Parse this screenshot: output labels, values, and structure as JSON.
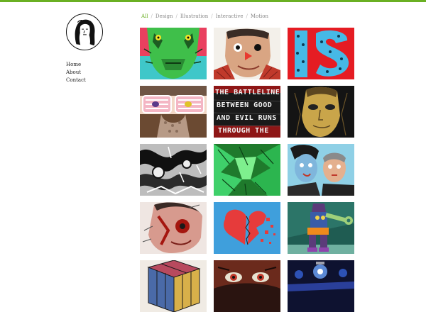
{
  "theme": {
    "accent": "#6ab023",
    "text": "#222222",
    "muted": "#888888"
  },
  "logo": {
    "icon": "portrait-sketch-icon"
  },
  "nav": {
    "items": [
      {
        "label": "Home"
      },
      {
        "label": "About"
      },
      {
        "label": "Contact"
      }
    ]
  },
  "filters": {
    "items": [
      {
        "label": "All",
        "active": true
      },
      {
        "label": "Design",
        "active": false
      },
      {
        "label": "Illustration",
        "active": false
      },
      {
        "label": "Interactive",
        "active": false
      },
      {
        "label": "Motion",
        "active": false
      }
    ]
  },
  "portfolio": {
    "tiles": [
      {
        "name": "tile-green-creature"
      },
      {
        "name": "tile-clown-face"
      },
      {
        "name": "tile-is-lettering",
        "text": "IS"
      },
      {
        "name": "tile-glasses-man"
      },
      {
        "name": "tile-battleline-text",
        "lines": [
          "THE BATTLELINE",
          "BETWEEN GOOD",
          "AND EVIL RUNS",
          "THROUGH THE"
        ]
      },
      {
        "name": "tile-golden-mask"
      },
      {
        "name": "tile-bw-abstract"
      },
      {
        "name": "tile-green-abstract"
      },
      {
        "name": "tile-couple-portrait"
      },
      {
        "name": "tile-painted-face"
      },
      {
        "name": "tile-broken-heart"
      },
      {
        "name": "tile-robot-wrench"
      },
      {
        "name": "tile-mosaic-cube"
      },
      {
        "name": "tile-red-eyes"
      },
      {
        "name": "tile-blue-lights"
      }
    ]
  }
}
